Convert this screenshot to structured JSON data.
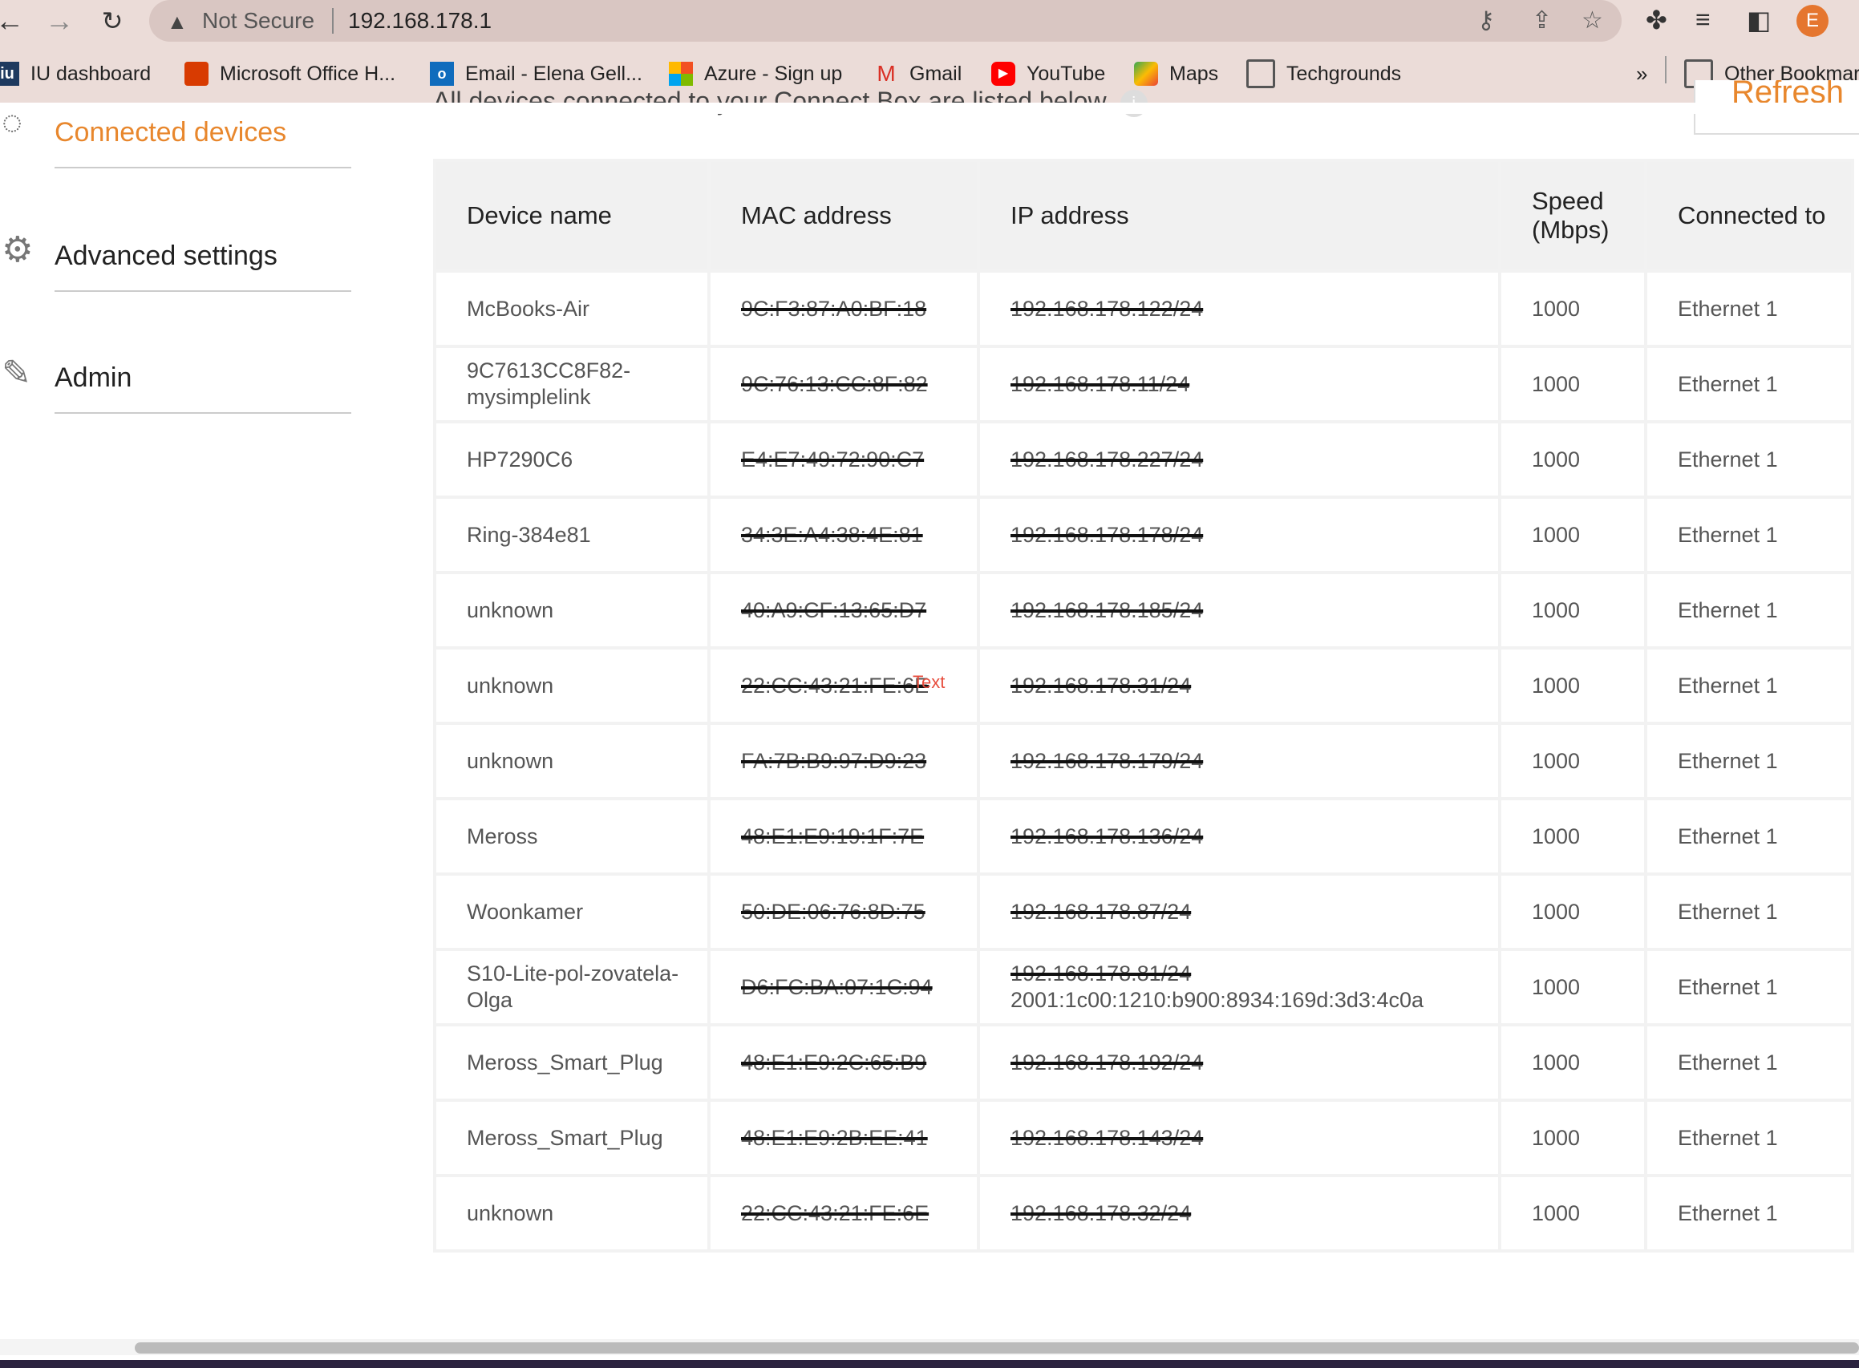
{
  "browser": {
    "security_label": "Not Secure",
    "url": "192.168.178.1",
    "profile_initial": "E",
    "bookmarks": [
      {
        "label": "IU dashboard",
        "icon": "iu-icon"
      },
      {
        "label": "Microsoft Office H...",
        "icon": "office-icon"
      },
      {
        "label": "Email - Elena Gell...",
        "icon": "outlook-icon"
      },
      {
        "label": "Azure - Sign up",
        "icon": "microsoft-icon"
      },
      {
        "label": "Gmail",
        "icon": "gmail-icon"
      },
      {
        "label": "YouTube",
        "icon": "youtube-icon"
      },
      {
        "label": "Maps",
        "icon": "maps-icon"
      },
      {
        "label": "Techgrounds",
        "icon": "folder-icon"
      }
    ],
    "overflow_label": "»",
    "other_bookmarks": "Other Bookmarks"
  },
  "sidebar": {
    "items": [
      {
        "label": "Connected devices",
        "icon": "devices-icon",
        "active": true
      },
      {
        "label": "Advanced settings",
        "icon": "gear-icon",
        "active": false
      },
      {
        "label": "Admin",
        "icon": "pencil-icon",
        "active": false
      }
    ]
  },
  "main": {
    "intro": "All devices connected to your Connect Box are listed below.",
    "refresh_label": "Refresh",
    "annotation": "Text",
    "columns": [
      "Device name",
      "MAC address",
      "IP address",
      "Speed (Mbps)",
      "Connected to"
    ],
    "rows": [
      {
        "name": "McBooks-Air",
        "mac": "9C:F3:87:A0:BF:18",
        "ip": "192.168.178.122/24",
        "ip2": "",
        "speed": "1000",
        "conn": "Ethernet 1"
      },
      {
        "name": "9C7613CC8F82-mysimplelink",
        "mac": "9C:76:13:CC:8F:82",
        "ip": "192.168.178.11/24",
        "ip2": "",
        "speed": "1000",
        "conn": "Ethernet 1"
      },
      {
        "name": "HP7290C6",
        "mac": "E4:E7:49:72:90:C7",
        "ip": "192.168.178.227/24",
        "ip2": "",
        "speed": "1000",
        "conn": "Ethernet 1"
      },
      {
        "name": "Ring-384e81",
        "mac": "34:3E:A4:38:4E:81",
        "ip": "192.168.178.178/24",
        "ip2": "",
        "speed": "1000",
        "conn": "Ethernet 1"
      },
      {
        "name": "unknown",
        "mac": "40:A9:CF:13:65:D7",
        "ip": "192.168.178.185/24",
        "ip2": "",
        "speed": "1000",
        "conn": "Ethernet 1"
      },
      {
        "name": "unknown",
        "mac": "22:CC:43:21:FE:6E",
        "ip": "192.168.178.31/24",
        "ip2": "",
        "speed": "1000",
        "conn": "Ethernet 1"
      },
      {
        "name": "unknown",
        "mac": "FA:7B:B9:97:D9:23",
        "ip": "192.168.178.179/24",
        "ip2": "",
        "speed": "1000",
        "conn": "Ethernet 1"
      },
      {
        "name": "Meross",
        "mac": "48:E1:E9:19:1F:7E",
        "ip": "192.168.178.136/24",
        "ip2": "",
        "speed": "1000",
        "conn": "Ethernet 1"
      },
      {
        "name": "Woonkamer",
        "mac": "50:DE:06:76:8D:75",
        "ip": "192.168.178.87/24",
        "ip2": "",
        "speed": "1000",
        "conn": "Ethernet 1"
      },
      {
        "name": "S10-Lite-pol-zovatela-Olga",
        "mac": "D6:FC:BA:07:1C:94",
        "ip": "192.168.178.81/24",
        "ip2": "2001:1c00:1210:b900:8934:169d:3d3:4c0a",
        "speed": "1000",
        "conn": "Ethernet 1"
      },
      {
        "name": "Meross_Smart_Plug",
        "mac": "48:E1:E9:2C:65:B9",
        "ip": "192.168.178.192/24",
        "ip2": "",
        "speed": "1000",
        "conn": "Ethernet 1"
      },
      {
        "name": "Meross_Smart_Plug",
        "mac": "48:E1:E9:2B:EE:41",
        "ip": "192.168.178.143/24",
        "ip2": "",
        "speed": "1000",
        "conn": "Ethernet 1"
      },
      {
        "name": "unknown",
        "mac": "22:CC:43:21:FE:6E",
        "ip": "192.168.178.32/24",
        "ip2": "",
        "speed": "1000",
        "conn": "Ethernet 1"
      }
    ]
  }
}
